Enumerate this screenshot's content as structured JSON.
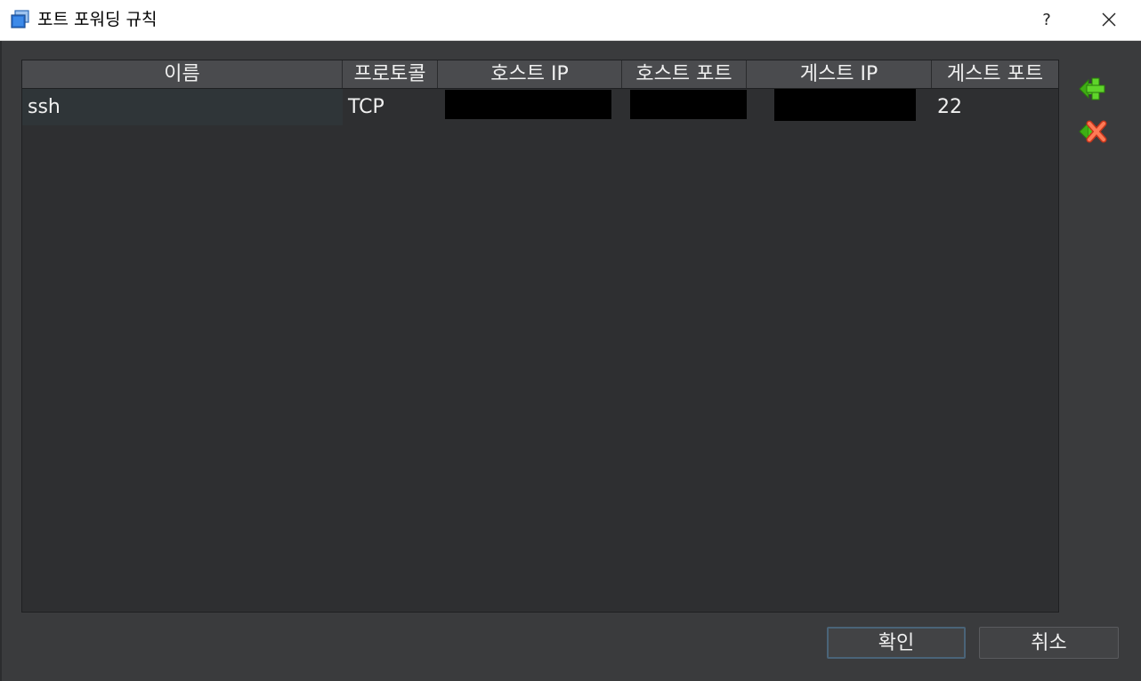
{
  "window": {
    "title": "포트 포워딩 규칙",
    "help_label": "?"
  },
  "table": {
    "columns": [
      "이름",
      "프로토콜",
      "호스트 IP",
      "호스트 포트",
      "게스트 IP",
      "게스트 포트"
    ],
    "rows": [
      {
        "name": "ssh",
        "protocol": "TCP",
        "host_ip": "",
        "host_port": "",
        "guest_ip": "",
        "guest_port": "22"
      }
    ]
  },
  "actions": {
    "add_icon": "add-rule-icon",
    "remove_icon": "remove-rule-icon"
  },
  "buttons": {
    "ok": "확인",
    "cancel": "취소"
  },
  "colors": {
    "background": "#3a3b3d",
    "table_bg": "#2e2f31",
    "header_bg": "#4a4b4e",
    "add_green": "#4cc21a",
    "remove_red": "#ee5533"
  }
}
